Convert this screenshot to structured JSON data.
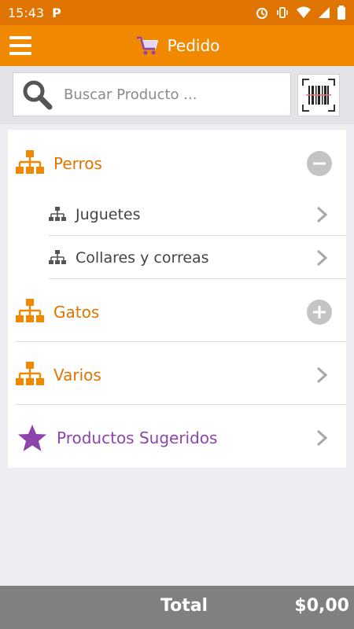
{
  "status_bar": {
    "time": "15:43",
    "app_indicator": "P"
  },
  "header": {
    "title": "Pedido",
    "menu_icon": "hamburger-icon",
    "cart_icon": "cart-icon"
  },
  "search": {
    "placeholder": "Buscar Producto ...",
    "value": ""
  },
  "categories": {
    "perros": {
      "label": "Perros",
      "state": "expanded"
    },
    "subcategories": [
      {
        "label": "Juguetes"
      },
      {
        "label": "Collares y correas"
      }
    ],
    "gatos": {
      "label": "Gatos",
      "state": "collapsed"
    },
    "varios": {
      "label": "Varios"
    },
    "sugeridos": {
      "label": "Productos Sugeridos"
    }
  },
  "footer": {
    "total_label": "Total",
    "total_value": "$0,00"
  },
  "colors": {
    "accent": "#f08800",
    "status": "#e07400",
    "purple": "#8e44ad",
    "footer": "#808080"
  }
}
